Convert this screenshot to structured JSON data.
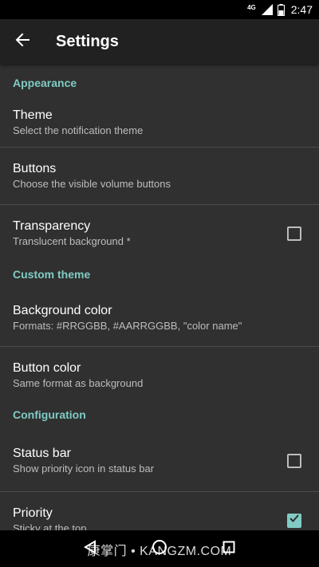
{
  "status_bar": {
    "network_label": "4G",
    "time": "2:47"
  },
  "app_bar": {
    "title": "Settings"
  },
  "sections": [
    {
      "header": "Appearance",
      "items": [
        {
          "title": "Theme",
          "summary": "Select the notification theme"
        },
        {
          "title": "Buttons",
          "summary": "Choose the visible volume buttons"
        },
        {
          "title": "Transparency",
          "summary": "Translucent background *",
          "checked": false
        }
      ]
    },
    {
      "header": "Custom theme",
      "items": [
        {
          "title": "Background color",
          "summary": "Formats: #RRGGBB, #AARRGGBB, \"color name\""
        },
        {
          "title": "Button color",
          "summary": "Same format as background"
        }
      ]
    },
    {
      "header": "Configuration",
      "items": [
        {
          "title": "Status bar",
          "summary": "Show priority icon in status bar",
          "checked": false
        },
        {
          "title": "Priority",
          "summary": "Sticky at the top",
          "checked": true
        }
      ]
    }
  ],
  "watermark": "康掌门 • KANGZM.COM",
  "icons": {
    "back": "arrow-left-icon",
    "nav_back": "triangle-back-icon",
    "nav_home": "circle-home-icon",
    "nav_recents": "square-recents-icon"
  },
  "colors": {
    "accent": "#80cbc4",
    "background": "#303030",
    "app_bar": "#212121"
  }
}
